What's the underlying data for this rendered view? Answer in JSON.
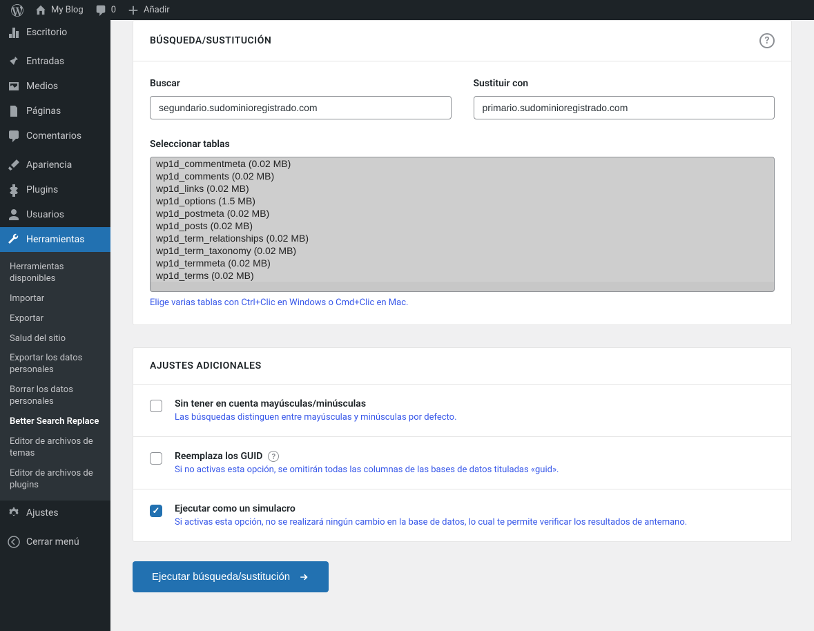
{
  "topbar": {
    "site_name": "My Blog",
    "comments_count": "0",
    "add_label": "Añadir"
  },
  "sidebar": {
    "items": [
      {
        "label": "Escritorio"
      },
      {
        "label": "Entradas"
      },
      {
        "label": "Medios"
      },
      {
        "label": "Páginas"
      },
      {
        "label": "Comentarios"
      },
      {
        "label": "Apariencia"
      },
      {
        "label": "Plugins"
      },
      {
        "label": "Usuarios"
      },
      {
        "label": "Herramientas"
      },
      {
        "label": "Ajustes"
      },
      {
        "label": "Cerrar menú"
      }
    ],
    "submenu": [
      {
        "label": "Herramientas disponibles"
      },
      {
        "label": "Importar"
      },
      {
        "label": "Exportar"
      },
      {
        "label": "Salud del sitio"
      },
      {
        "label": "Exportar los datos personales"
      },
      {
        "label": "Borrar los datos personales"
      },
      {
        "label": "Better Search Replace"
      },
      {
        "label": "Editor de archivos de temas"
      },
      {
        "label": "Editor de archivos de plugins"
      }
    ]
  },
  "search_panel": {
    "title": "BÚSQUEDA/SUSTITUCIÓN",
    "search_label": "Buscar",
    "search_value": "segundario.sudominioregistrado.com",
    "replace_label": "Sustituir con",
    "replace_value": "primario.sudominioregistrado.com",
    "tables_label": "Seleccionar tablas",
    "tables": [
      "wp1d_commentmeta (0.02 MB)",
      "wp1d_comments (0.02 MB)",
      "wp1d_links (0.02 MB)",
      "wp1d_options (1.5 MB)",
      "wp1d_postmeta (0.02 MB)",
      "wp1d_posts (0.02 MB)",
      "wp1d_term_relationships (0.02 MB)",
      "wp1d_term_taxonomy (0.02 MB)",
      "wp1d_termmeta (0.02 MB)",
      "wp1d_terms (0.02 MB)"
    ],
    "tables_hint": "Elige varias tablas con Ctrl+Clic en Windows o Cmd+Clic en Mac."
  },
  "settings_panel": {
    "title": "AJUSTES ADICIONALES",
    "rows": [
      {
        "title": "Sin tener en cuenta mayúsculas/minúsculas",
        "desc": "Las búsquedas distinguen entre mayúsculas y minúsculas por defecto.",
        "checked": false
      },
      {
        "title": "Reemplaza los GUID",
        "desc": "Si no activas esta opción, se omitirán todas las columnas de las bases de datos tituladas «guid».",
        "checked": false,
        "info": true
      },
      {
        "title": "Ejecutar como un simulacro",
        "desc": "Si activas esta opción, no se realizará ningún cambio en la base de datos, lo cual te permite verificar los resultados de antemano.",
        "checked": true
      }
    ]
  },
  "run_button": "Ejecutar búsqueda/sustitución"
}
